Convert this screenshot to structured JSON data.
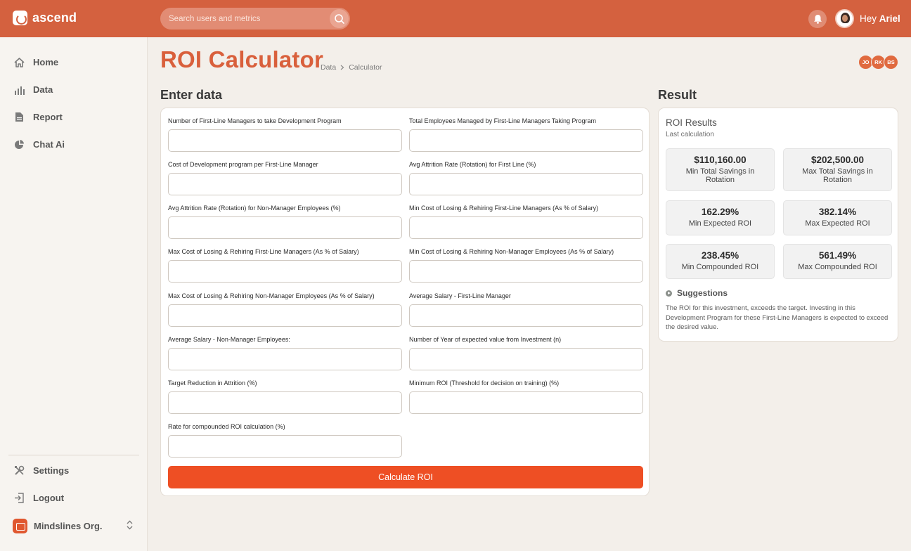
{
  "app": {
    "brand": "ascend"
  },
  "header": {
    "search_placeholder": "Search users and metrics",
    "greeting_prefix": "Hey",
    "user_name": "Ariel"
  },
  "sidebar": {
    "items": [
      {
        "label": "Home",
        "icon": "home-icon"
      },
      {
        "label": "Data",
        "icon": "bar-chart-icon"
      },
      {
        "label": "Report",
        "icon": "document-icon"
      },
      {
        "label": "Chat Ai",
        "icon": "pie-chart-icon"
      }
    ],
    "bottom": [
      {
        "label": "Settings",
        "icon": "tools-icon"
      },
      {
        "label": "Logout",
        "icon": "logout-icon"
      }
    ],
    "org": "Mindslines Org."
  },
  "page": {
    "title": "ROI Calculator",
    "breadcrumb": [
      "Data",
      "Calculator"
    ],
    "collaborators": [
      "JO",
      "RK",
      "BS"
    ]
  },
  "form": {
    "section_title": "Enter data",
    "fields": [
      {
        "label": "Number of First-Line Managers to take Development Program",
        "value": ""
      },
      {
        "label": "Total Employees Managed by First-Line Managers Taking Program",
        "value": ""
      },
      {
        "label": "Cost of Development program per First-Line Manager",
        "value": ""
      },
      {
        "label": "Avg Attrition Rate (Rotation) for First Line (%)",
        "value": ""
      },
      {
        "label": "Avg Attrition Rate (Rotation) for Non-Manager Employees (%)",
        "value": ""
      },
      {
        "label": "Min Cost of Losing & Rehiring First-Line Managers (As % of Salary)",
        "value": ""
      },
      {
        "label": "Max Cost of Losing & Rehiring First-Line Managers (As % of Salary)",
        "value": ""
      },
      {
        "label": "Min Cost of Losing & Rehiring Non-Manager Employees (As % of Salary)",
        "value": ""
      },
      {
        "label": "Max Cost of Losing & Rehiring Non-Manager Employees (As % of Salary)",
        "value": ""
      },
      {
        "label": "Average Salary - First-Line Manager",
        "value": ""
      },
      {
        "label": "Average Salary - Non-Manager Employees:",
        "value": ""
      },
      {
        "label": "Number of Year of expected value from Investment (n)",
        "value": ""
      },
      {
        "label": "Target Reduction in Attrition (%)",
        "value": ""
      },
      {
        "label": "Minimum ROI (Threshold for decision on training) (%)",
        "value": ""
      },
      {
        "label": "Rate for compounded ROI calculation (%)",
        "value": ""
      }
    ],
    "submit_label": "Calculate ROI"
  },
  "result": {
    "section_title": "Result",
    "card_title": "ROI Results",
    "card_subtitle": "Last calculation",
    "tiles": [
      {
        "value": "$110,160.00",
        "label": "Min Total Savings in Rotation"
      },
      {
        "value": "$202,500.00",
        "label": "Max Total Savings in Rotation"
      },
      {
        "value": "162.29%",
        "label": "Min Expected ROI"
      },
      {
        "value": "382.14%",
        "label": "Max Expected ROI"
      },
      {
        "value": "238.45%",
        "label": "Min Compounded ROI"
      },
      {
        "value": "561.49%",
        "label": "Max Compounded ROI"
      }
    ],
    "suggestions_title": "Suggestions",
    "suggestions_text": "The ROI for this investment, exceeds the target. Investing in this Development Program for these First-Line Managers is expected to exceed the desired value."
  },
  "colors": {
    "brand": "#d4613f",
    "accent_button": "#ee4f24",
    "title": "#d9603c",
    "background": "#f3efea"
  }
}
